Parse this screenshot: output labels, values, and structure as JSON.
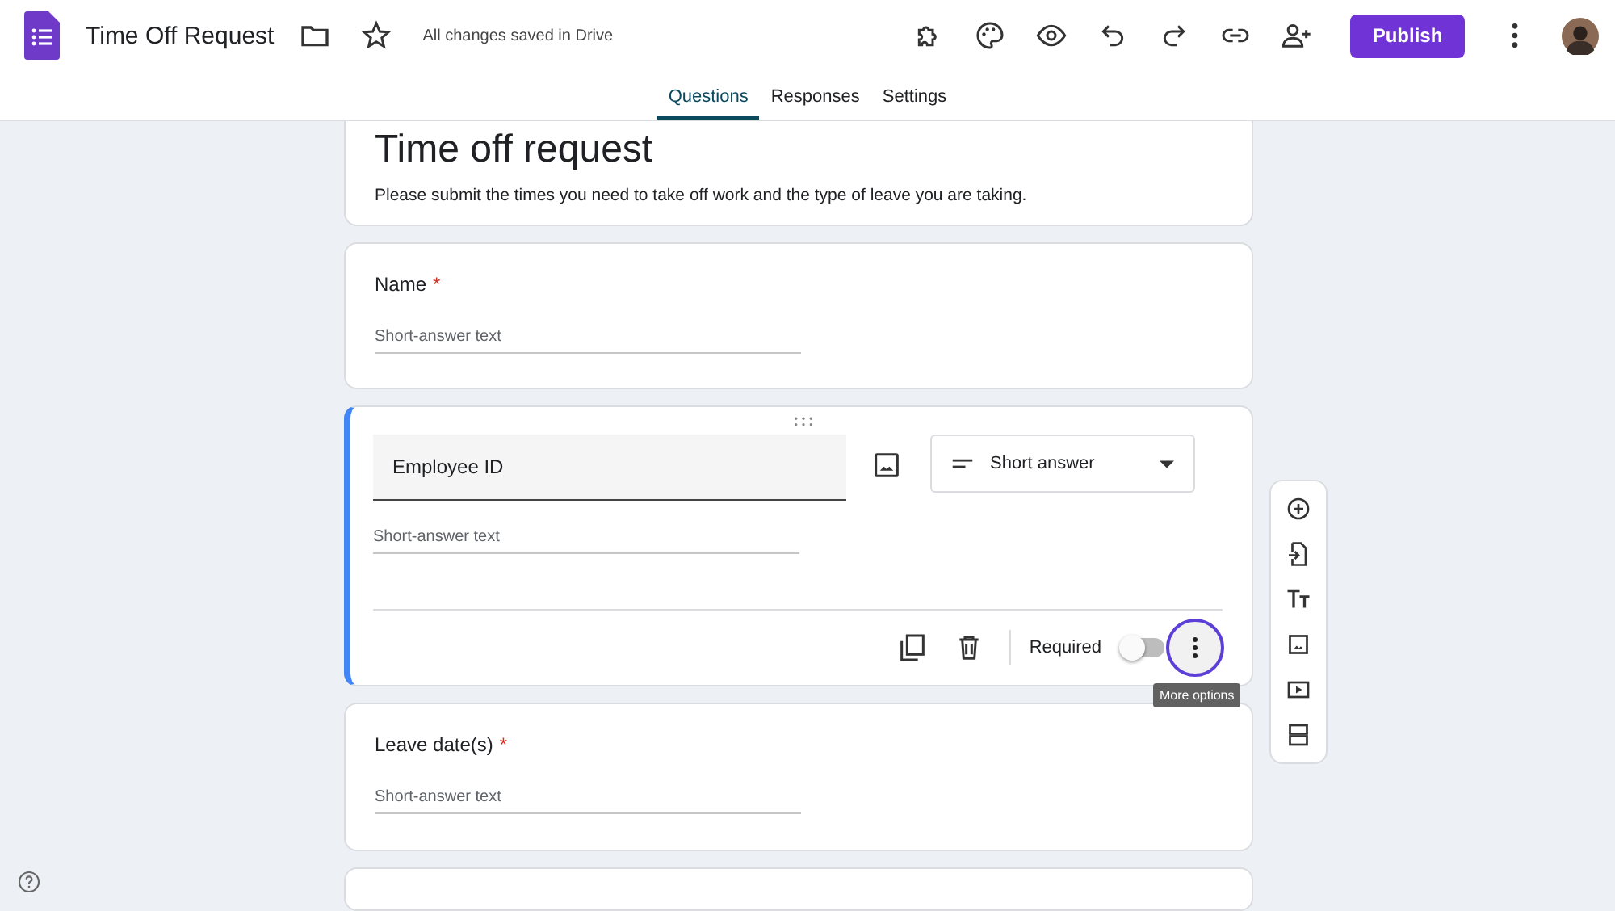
{
  "app": {
    "title": "Time Off Request",
    "save_status": "All changes saved in Drive",
    "publish_button": "Publish"
  },
  "tabs": [
    {
      "label": "Questions",
      "selected": true
    },
    {
      "label": "Responses",
      "selected": false
    },
    {
      "label": "Settings",
      "selected": false
    }
  ],
  "form": {
    "title": "Time off request",
    "description": "Please submit the times you need to take off work and the type of leave you are taking."
  },
  "questions": [
    {
      "title": "Name",
      "required": true,
      "required_mark": "*",
      "placeholder": "Short-answer text",
      "selected": false
    },
    {
      "title": "Employee ID",
      "required": false,
      "placeholder": "Short-answer text",
      "selected": true,
      "type": "Short answer",
      "required_label": "Required",
      "tooltip": "More options"
    },
    {
      "title": "Leave date(s)",
      "required": true,
      "required_mark": "*",
      "placeholder": "Short-answer text",
      "selected": false
    }
  ]
}
